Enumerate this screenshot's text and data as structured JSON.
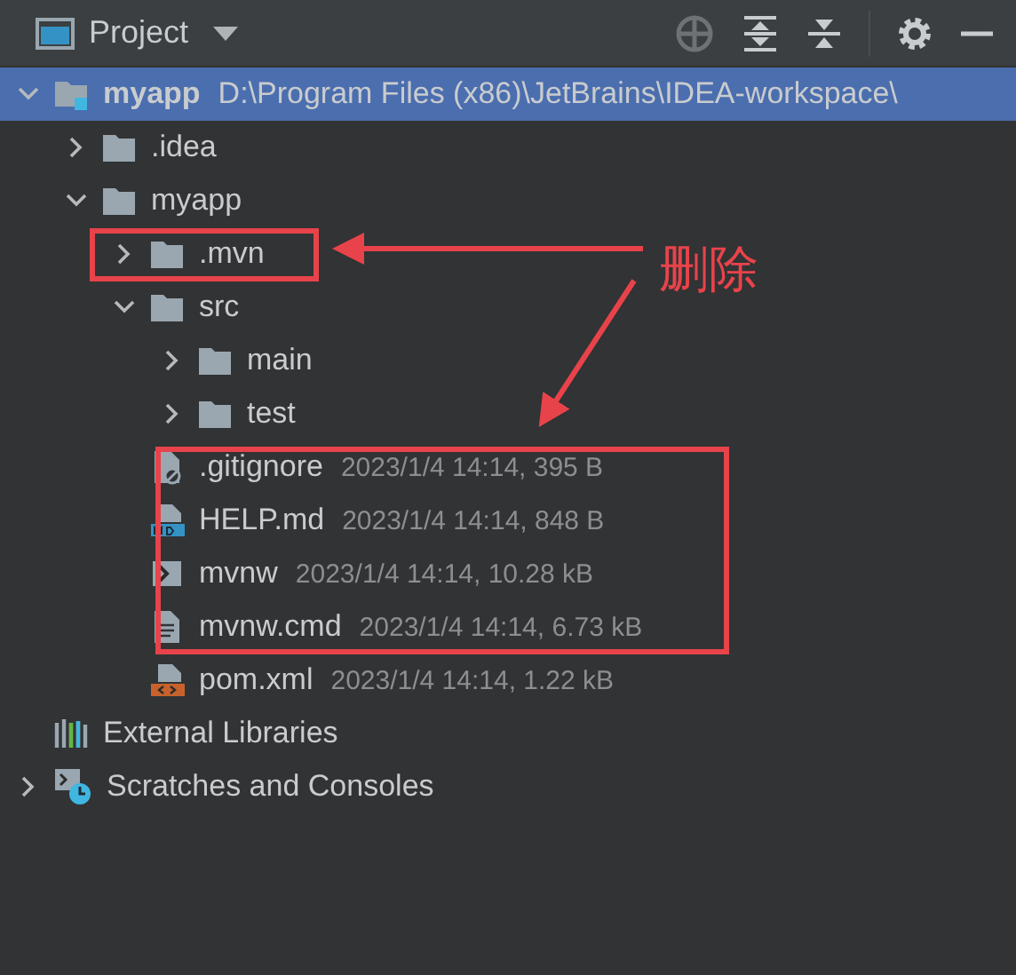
{
  "panel": {
    "title": "Project"
  },
  "tree": [
    {
      "name": "myapp",
      "kind": "project",
      "meta": "D:\\Program Files (x86)\\JetBrains\\IDEA-workspace\\",
      "expanded": true,
      "selected": true,
      "children": [
        {
          "name": ".idea",
          "kind": "folder",
          "expanded": false,
          "selected": false
        },
        {
          "name": "myapp",
          "kind": "folder",
          "expanded": true,
          "selected": false,
          "children": [
            {
              "name": ".mvn",
              "kind": "folder",
              "expanded": false,
              "selected": false
            },
            {
              "name": "src",
              "kind": "folder",
              "expanded": true,
              "selected": false,
              "children": [
                {
                  "name": "main",
                  "kind": "folder",
                  "expanded": false,
                  "selected": false
                },
                {
                  "name": "test",
                  "kind": "folder",
                  "expanded": false,
                  "selected": false
                }
              ]
            },
            {
              "name": ".gitignore",
              "kind": "ignore",
              "meta": "2023/1/4 14:14, 395 B",
              "selected": false
            },
            {
              "name": "HELP.md",
              "kind": "markdown",
              "meta": "2023/1/4 14:14, 848 B",
              "selected": false
            },
            {
              "name": "mvnw",
              "kind": "shell",
              "meta": "2023/1/4 14:14, 10.28 kB",
              "selected": false
            },
            {
              "name": "mvnw.cmd",
              "kind": "text",
              "meta": "2023/1/4 14:14, 6.73 kB",
              "selected": false
            },
            {
              "name": "pom.xml",
              "kind": "xml",
              "meta": "2023/1/4 14:14, 1.22 kB",
              "selected": false
            }
          ]
        }
      ]
    },
    {
      "name": "External Libraries",
      "kind": "libraries",
      "selected": false
    },
    {
      "name": "Scratches and Consoles",
      "kind": "scratches",
      "expanded": false,
      "selected": false
    }
  ],
  "annotation": {
    "label": "删除"
  }
}
